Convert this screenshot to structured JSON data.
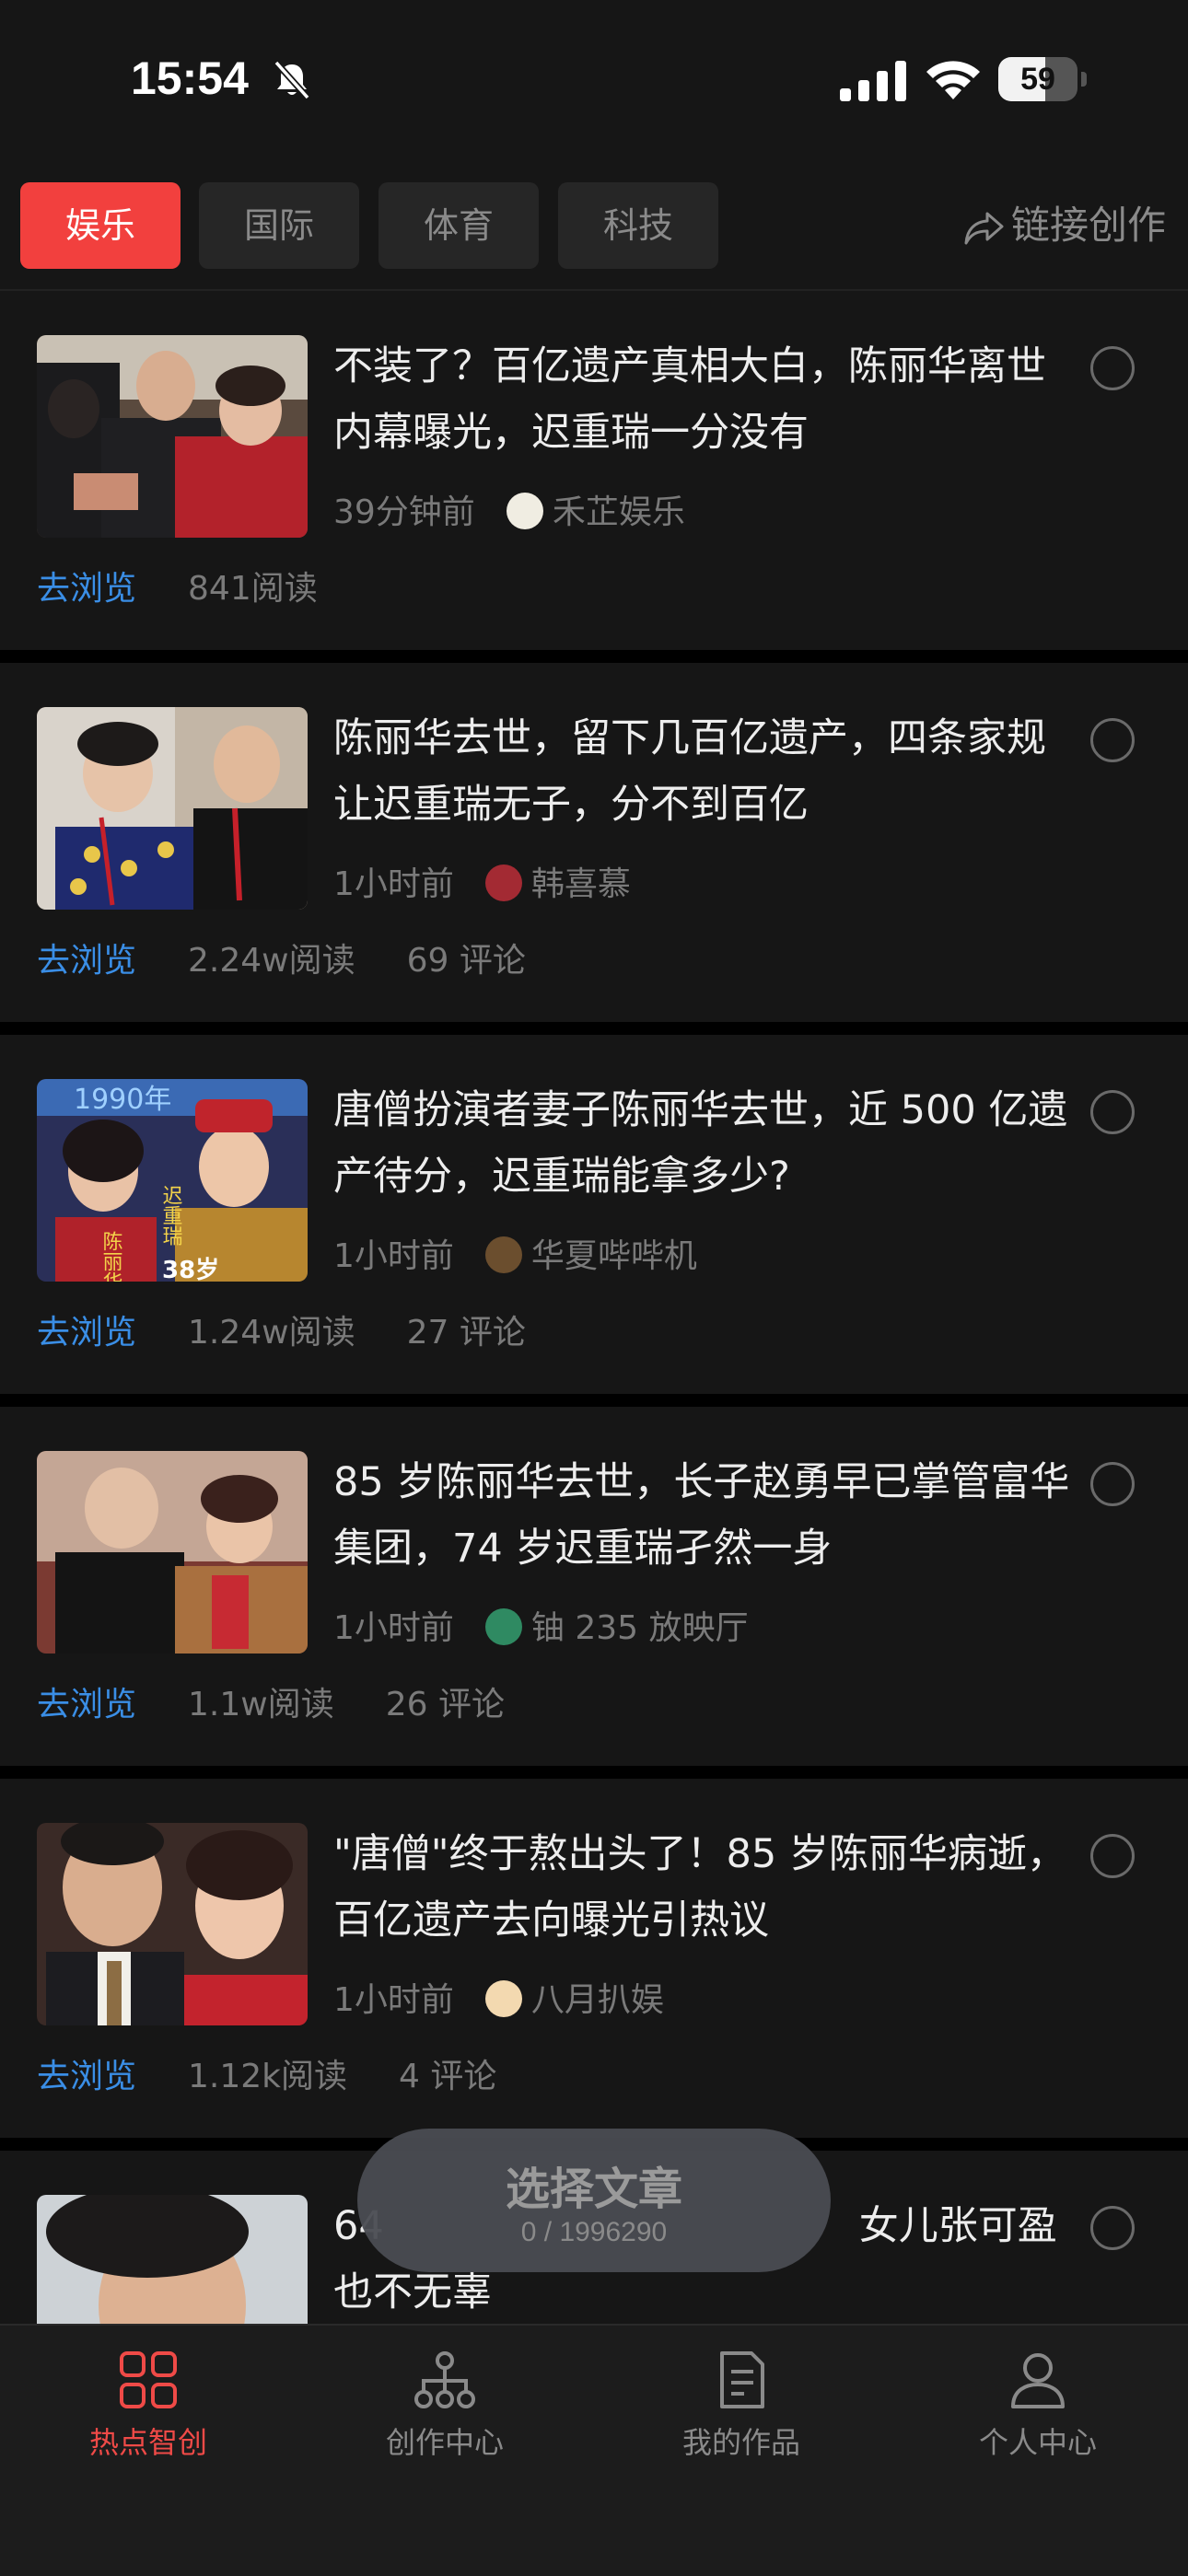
{
  "status": {
    "time": "15:54",
    "battery_percent": 59,
    "battery_label": "59"
  },
  "tabs": [
    {
      "label": "娱乐",
      "active": true
    },
    {
      "label": "国际",
      "active": false
    },
    {
      "label": "体育",
      "active": false
    },
    {
      "label": "科技",
      "active": false
    }
  ],
  "link_create_label": "链接创作",
  "colors": {
    "accent": "#f2403e",
    "link_blue": "#3a8ee6",
    "background": "#161616"
  },
  "articles": [
    {
      "title": "不装了？百亿遗产真相大白，陈丽华离世内幕曝光，迟重瑞一分没有",
      "time": "39分钟前",
      "author": "禾芷娱乐",
      "action": "去浏览",
      "reads": "841阅读",
      "comments": ""
    },
    {
      "title": "陈丽华去世，留下几百亿遗产，四条家规让迟重瑞无子，分不到百亿",
      "time": "1小时前",
      "author": "韩喜慕",
      "action": "去浏览",
      "reads": "2.24w阅读",
      "comments": "69 评论"
    },
    {
      "title": "唐僧扮演者妻子陈丽华去世，近 500 亿遗产待分，迟重瑞能拿多少?",
      "time": "1小时前",
      "author": "华夏哔哔机",
      "action": "去浏览",
      "reads": "1.24w阅读",
      "comments": "27 评论"
    },
    {
      "title": "85 岁陈丽华去世，长子赵勇早已掌管富华集团，74 岁迟重瑞孑然一身",
      "time": "1小时前",
      "author": "铀 235 放映厅",
      "action": "去浏览",
      "reads": "1.1w阅读",
      "comments": "26 评论"
    },
    {
      "title": "\"唐僧\"终于熬出头了！85 岁陈丽华病逝，百亿遗产去向曝光引热议",
      "time": "1小时前",
      "author": "八月扒娱",
      "action": "去浏览",
      "reads": "1.12k阅读",
      "comments": "4 评论"
    },
    {
      "title": "64　　　　　　　　　　　　女儿张可盈也不无辜",
      "time": "",
      "author": "",
      "action": "",
      "reads": "",
      "comments": ""
    }
  ],
  "pill": {
    "title": "选择文章",
    "count": "0 / 1996290"
  },
  "thumb_text": {
    "year": "1990年",
    "name_left": "陈丽华",
    "name_right": "迟重瑞",
    "age": "38岁"
  },
  "nav": [
    {
      "label": "热点智创",
      "icon": "grid-icon",
      "active": true
    },
    {
      "label": "创作中心",
      "icon": "hierarchy-icon",
      "active": false
    },
    {
      "label": "我的作品",
      "icon": "document-icon",
      "active": false
    },
    {
      "label": "个人中心",
      "icon": "person-icon",
      "active": false
    }
  ]
}
